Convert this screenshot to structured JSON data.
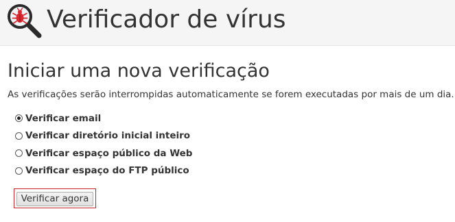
{
  "header": {
    "icon": "virus-scanner-icon",
    "title": "Verificador de vírus"
  },
  "scan": {
    "heading": "Iniciar uma nova verificação",
    "description": "As verificações serão interrompidas automaticamente se forem executadas por mais de um dia.",
    "options": [
      {
        "label": "Verificar email",
        "selected": true
      },
      {
        "label": "Verificar diretório inicial inteiro",
        "selected": false
      },
      {
        "label": "Verificar espaço público da Web",
        "selected": false
      },
      {
        "label": "Verificar espaço do FTP público",
        "selected": false
      }
    ],
    "button_label": "Verificar agora"
  },
  "colors": {
    "highlight_border": "#c81e28",
    "header_background": "#f5f5f5",
    "bug_red": "#d9282f"
  }
}
